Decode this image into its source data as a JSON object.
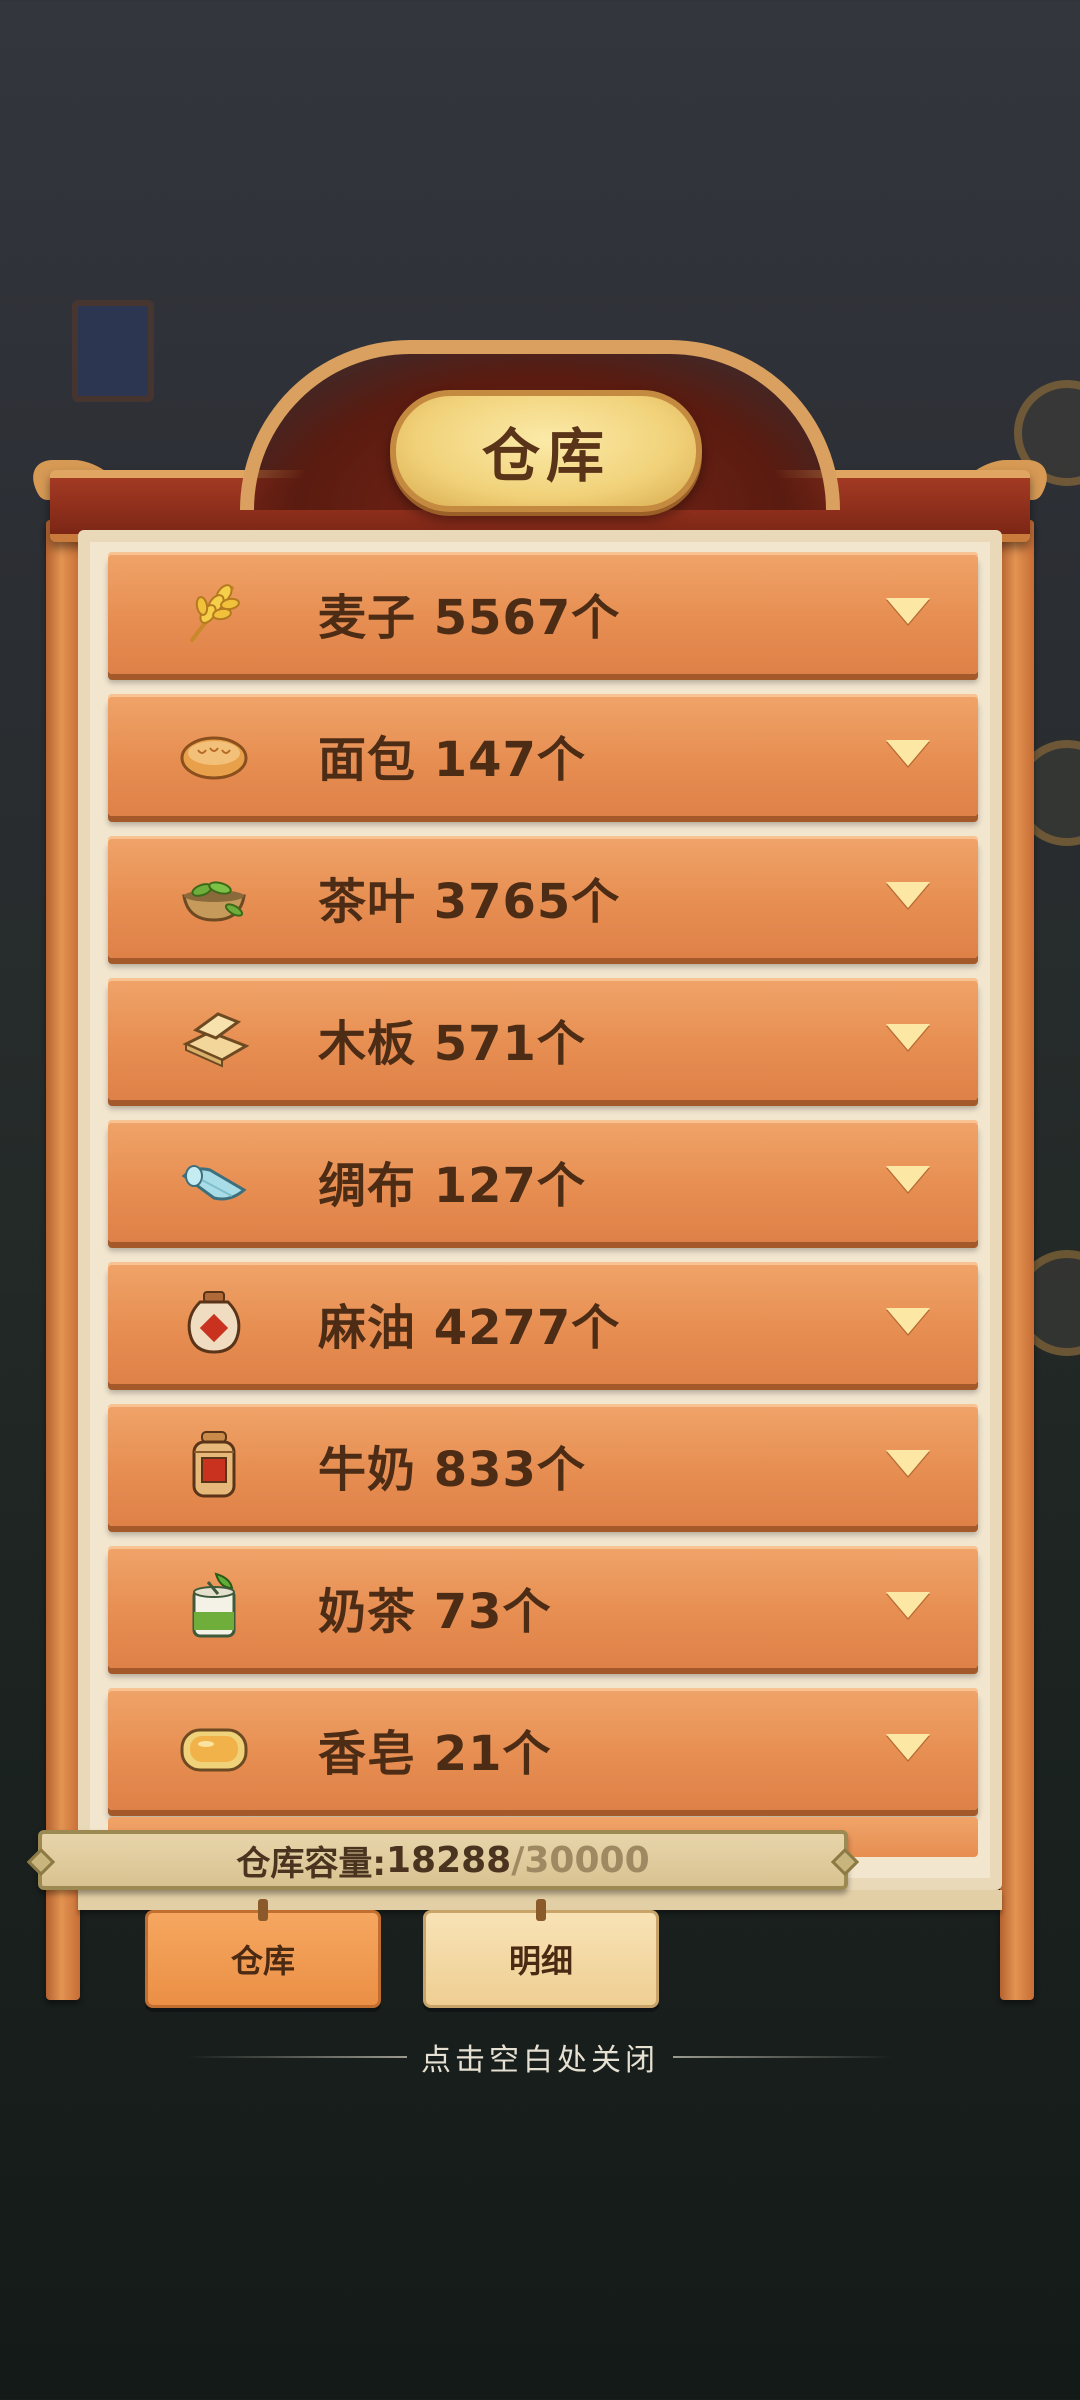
{
  "title": "仓库",
  "items": [
    {
      "name": "麦子",
      "count": "5567个",
      "label": "麦子 5567个",
      "icon": "wheat-icon"
    },
    {
      "name": "面包",
      "count": "147个",
      "label": "面包 147个",
      "icon": "bread-icon"
    },
    {
      "name": "茶叶",
      "count": "3765个",
      "label": "茶叶 3765个",
      "icon": "tea-leaves-icon"
    },
    {
      "name": "木板",
      "count": "571个",
      "label": "木板 571个",
      "icon": "wood-planks-icon"
    },
    {
      "name": "绸布",
      "count": "127个",
      "label": "绸布 127个",
      "icon": "silk-cloth-icon"
    },
    {
      "name": "麻油",
      "count": "4277个",
      "label": "麻油 4277个",
      "icon": "sesame-oil-jar-icon"
    },
    {
      "name": "牛奶",
      "count": "833个",
      "label": "牛奶 833个",
      "icon": "milk-jar-icon"
    },
    {
      "name": "奶茶",
      "count": "73个",
      "label": "奶茶 73个",
      "icon": "milk-tea-icon"
    },
    {
      "name": "香皂",
      "count": "21个",
      "label": "香皂 21个",
      "icon": "soap-icon"
    }
  ],
  "capacity": {
    "label": "仓库容量:",
    "used": "18288",
    "slash": "/",
    "total": "30000"
  },
  "tabs": {
    "warehouse": "仓库",
    "details": "明细"
  },
  "close_hint": "点击空白处关闭",
  "colors": {
    "item_wood": "#e78e52",
    "title_plaque": "#f1d27a",
    "active_tab": "#eb8f45",
    "inactive_tab": "#efcf93"
  }
}
